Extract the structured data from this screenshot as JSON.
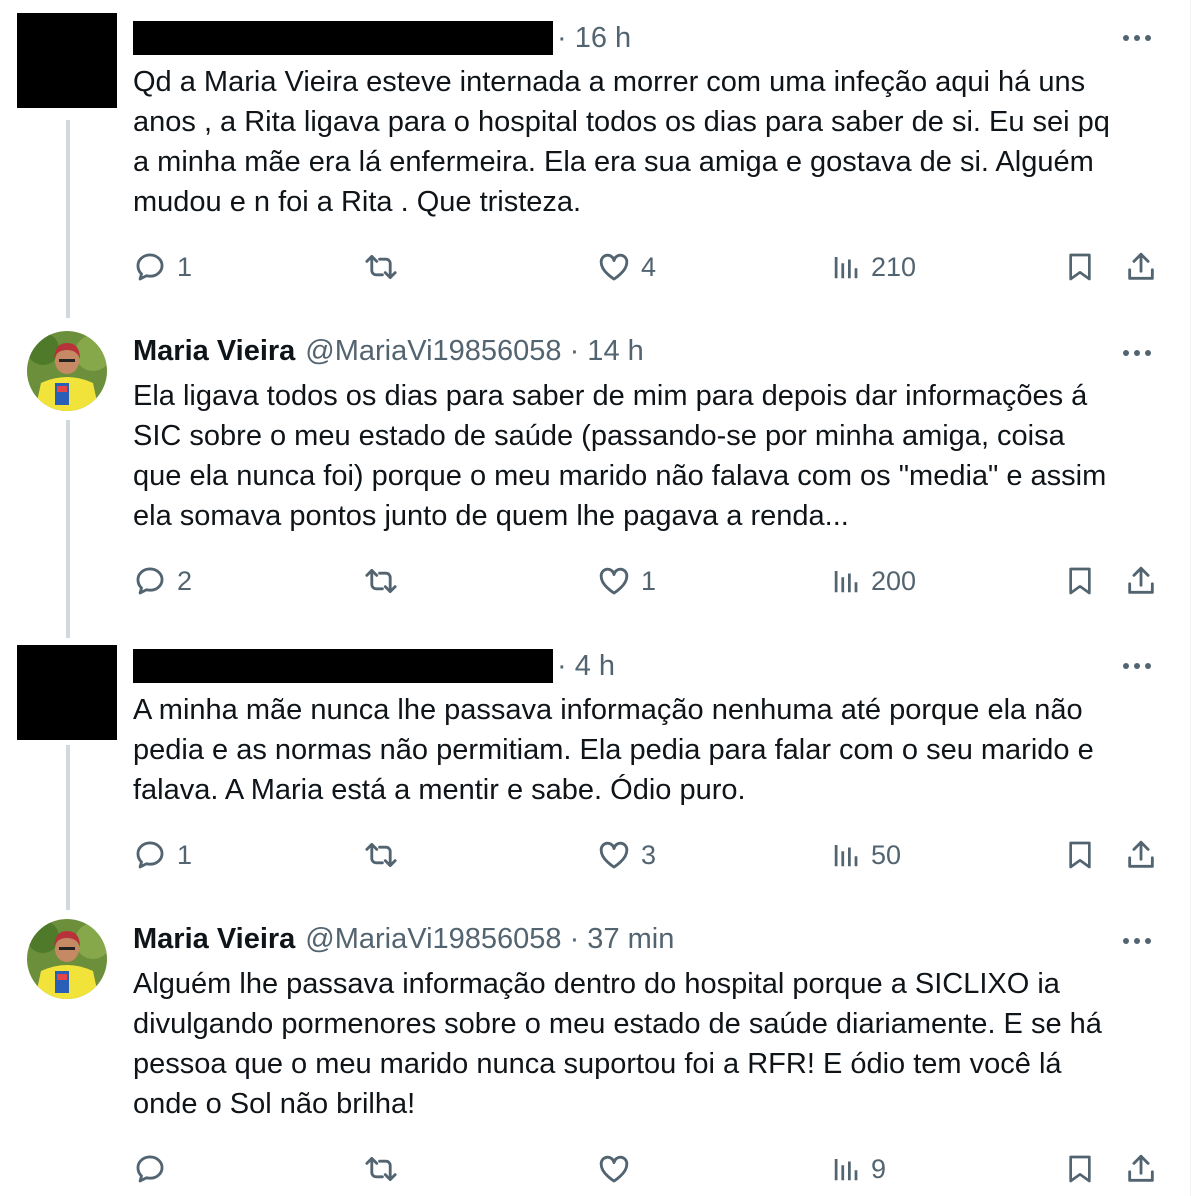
{
  "colors": {
    "text": "#0f1419",
    "secondary": "#536471",
    "thread_line": "#cfd9de"
  },
  "tweets": [
    {
      "author_redacted": true,
      "meta": "· 16 h",
      "text": "Qd a Maria Vieira esteve internada  a morrer  com uma infeção aqui há uns\nanos , a Rita ligava para o hospital todos  os dias para saber de si. Eu sei pq\na minha mãe era lá enfermeira. Ela era sua amiga e gostava de si. Alguém\nmudou e n foi a  Rita .  Que tristeza.",
      "replies": "1",
      "retweets": "",
      "likes": "4",
      "views": "210"
    },
    {
      "name": "Maria Vieira",
      "meta": "@MariaVi19856058 · 14 h",
      "text": "Ela ligava todos os dias para saber de mim para depois dar informações á\nSIC sobre o meu estado de saúde (passando-se por minha amiga, coisa\nque ela nunca foi) porque o meu marido não falava com os \"media\" e assim\nela somava pontos junto de quem lhe pagava a renda...",
      "replies": "2",
      "retweets": "",
      "likes": "1",
      "views": "200"
    },
    {
      "author_redacted": true,
      "meta": "· 4 h",
      "text": "A minha mãe nunca lhe passava informação nenhuma até porque ela não\npedia e as normas não permitiam. Ela pedia para falar com o seu marido e\nfalava. A Maria está a mentir e sabe. Ódio puro.",
      "replies": "1",
      "retweets": "",
      "likes": "3",
      "views": "50"
    },
    {
      "name": "Maria Vieira",
      "meta": "@MariaVi19856058 · 37 min",
      "text": "Alguém lhe passava informação dentro do hospital porque a SICLIXO ia\ndivulgando pormenores sobre o meu estado de saúde diariamente. E se há\npessoa que o meu marido nunca suportou foi a RFR! E ódio tem você lá\nonde o Sol não brilha!",
      "replies": "",
      "retweets": "",
      "likes": "",
      "views": "9"
    }
  ],
  "icons": [
    "reply-icon",
    "retweet-icon",
    "like-icon",
    "views-icon",
    "bookmark-icon",
    "share-icon",
    "more-icon"
  ]
}
